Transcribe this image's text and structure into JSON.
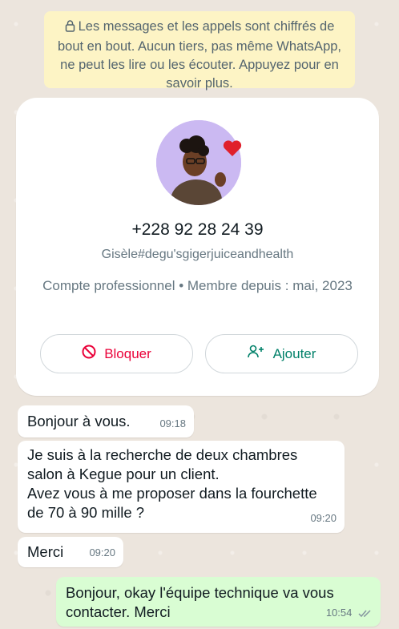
{
  "encryption_notice": "Les messages et les appels sont chiffrés de bout en bout. Aucun tiers, pas même WhatsApp, ne peut les lire ou les écouter. Appuyez pour en savoir plus.",
  "profile": {
    "phone": "+228 92 28 24 39",
    "username": "Gisèle#degu'sgigerjuiceandhealth",
    "business_info": "Compte professionnel • Membre depuis : mai, 2023",
    "block_label": "Bloquer",
    "add_label": "Ajouter"
  },
  "messages": [
    {
      "direction": "in",
      "text": "Bonjour à vous.",
      "time": "09:18"
    },
    {
      "direction": "in",
      "text": "Je suis à la recherche de deux chambres salon à Kegue pour un client.\nAvez vous à me proposer dans la fourchette de 70 à 90 mille ?",
      "time": "09:20"
    },
    {
      "direction": "in",
      "text": "Merci",
      "time": "09:20"
    },
    {
      "direction": "out",
      "text": "Bonjour,  okay l'équipe technique va vous contacter.  Merci",
      "time": "10:54"
    }
  ],
  "colors": {
    "accent_green": "#008069",
    "block_red": "#ea0038",
    "outgoing_bubble": "#d9fdd3",
    "notice_bg": "#fdf4c5"
  }
}
